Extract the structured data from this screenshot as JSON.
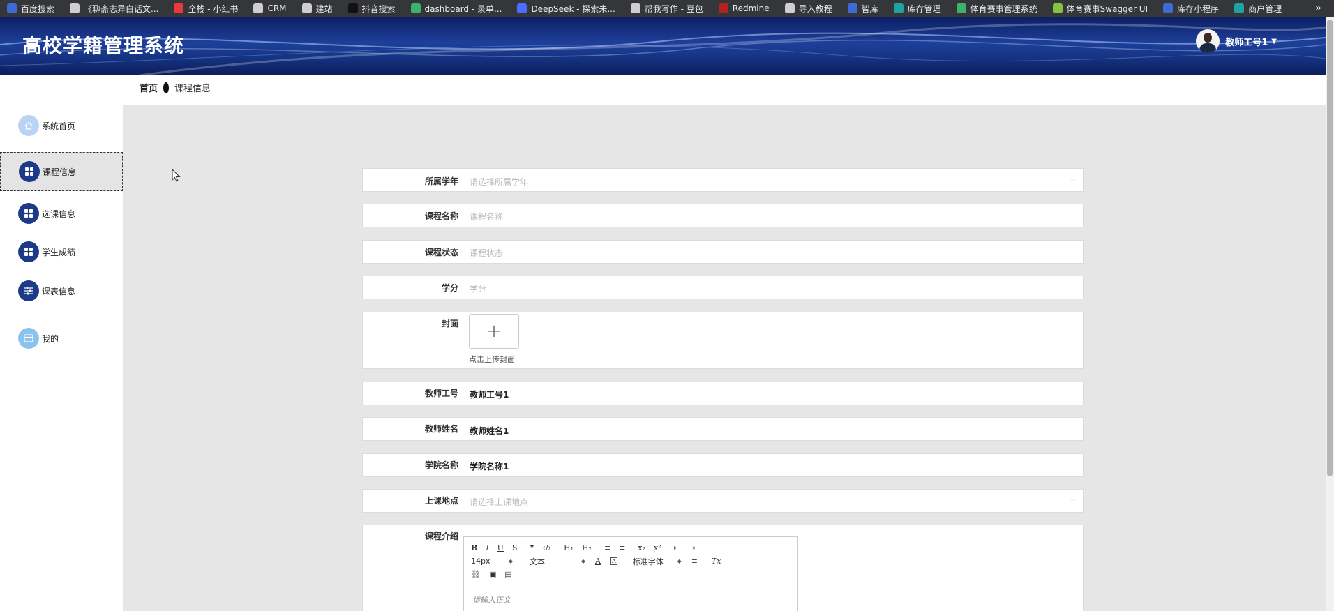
{
  "bookmarks": [
    {
      "label": "百度搜索",
      "color": "#3b6bd6"
    },
    {
      "label": "《聊斋志异白话文...",
      "color": "#cfcfcf"
    },
    {
      "label": "全栈 - 小红书",
      "color": "#e83a3a"
    },
    {
      "label": "CRM",
      "color": "#cfcfcf"
    },
    {
      "label": "建站",
      "color": "#cfcfcf"
    },
    {
      "label": "抖音搜索",
      "color": "#111111"
    },
    {
      "label": "dashboard - 录单...",
      "color": "#3bb36b"
    },
    {
      "label": "DeepSeek - 探索未...",
      "color": "#4d6bfe"
    },
    {
      "label": "帮我写作 - 豆包",
      "color": "#cfcfcf"
    },
    {
      "label": "Redmine",
      "color": "#b22222"
    },
    {
      "label": "导入教程",
      "color": "#cfcfcf"
    },
    {
      "label": "智库",
      "color": "#3b6bd6"
    },
    {
      "label": "库存管理",
      "color": "#1ea3a3"
    },
    {
      "label": "体育赛事管理系统",
      "color": "#3bb36b"
    },
    {
      "label": "体育赛事Swagger UI",
      "color": "#85c341"
    },
    {
      "label": "库存小程序",
      "color": "#3b6bd6"
    },
    {
      "label": "商户管理",
      "color": "#1ea3a3"
    }
  ],
  "bookmarks_more": "»",
  "header": {
    "title": "高校学籍管理系统",
    "user_name": "教师工号1",
    "caret": "▼"
  },
  "breadcrumb": {
    "home": "首页",
    "current": "课程信息"
  },
  "sidebar": {
    "items": [
      {
        "label": "系统首页",
        "icon": "home-icon"
      },
      {
        "label": "课程信息",
        "icon": "grid-icon",
        "active": true
      },
      {
        "label": "选课信息",
        "icon": "grid-icon"
      },
      {
        "label": "学生成绩",
        "icon": "grid-icon"
      },
      {
        "label": "课表信息",
        "icon": "sliders-icon"
      },
      {
        "label": "我的",
        "icon": "card-icon"
      }
    ]
  },
  "form": {
    "year": {
      "label": "所属学年",
      "placeholder": "请选择所属学年"
    },
    "course_name": {
      "label": "课程名称",
      "placeholder": "课程名称"
    },
    "course_status": {
      "label": "课程状态",
      "placeholder": "课程状态"
    },
    "credit": {
      "label": "学分",
      "placeholder": "学分"
    },
    "cover": {
      "label": "封面",
      "upload_icon": "+",
      "tip": "点击上传封面"
    },
    "teacher_id": {
      "label": "教师工号",
      "value": "教师工号1"
    },
    "teacher_name": {
      "label": "教师姓名",
      "value": "教师姓名1"
    },
    "college": {
      "label": "学院名称",
      "value": "学院名称1"
    },
    "location": {
      "label": "上课地点",
      "placeholder": "请选择上课地点"
    },
    "intro": {
      "label": "课程介绍",
      "toolbar": {
        "bold": "B",
        "italic": "I",
        "underline": "U",
        "strike": "S",
        "quote": "❞",
        "code": "‹/›",
        "h1": "H₁",
        "h2": "H₂",
        "ol": "≡",
        "ul": "≡",
        "sub": "x₂",
        "sup": "x²",
        "outdent": "⇤",
        "indent": "⇥",
        "size": "14px",
        "format": "文本",
        "color": "A",
        "bg": "A",
        "font": "标准字体",
        "align": "≡",
        "clean": "Tx",
        "link": "⛓",
        "image": "▣",
        "video": "▤"
      },
      "placeholder": "请输入正文"
    }
  }
}
